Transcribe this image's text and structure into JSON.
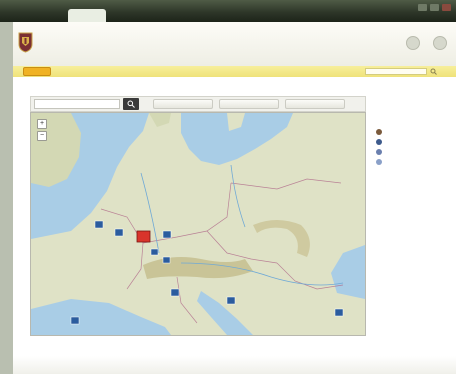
{
  "browser": {
    "tab_label": ""
  },
  "site": {
    "title": "",
    "header_links": [
      {
        "label": ""
      },
      {
        "label": ""
      }
    ]
  },
  "nav": {
    "menu_label": "",
    "links": [
      "",
      "",
      "",
      "",
      "",
      ""
    ],
    "search_placeholder": ""
  },
  "page": {
    "heading": ""
  },
  "map": {
    "search_placeholder": "",
    "toolbar_buttons": [
      "",
      "",
      ""
    ],
    "zoom_in_symbol": "+",
    "zoom_out_symbol": "−",
    "place_labels": [
      "",
      "",
      "",
      "",
      "",
      "",
      "",
      ""
    ]
  },
  "legend": {
    "title": "",
    "items": [
      {
        "label": "",
        "color": "#7a5a3c"
      },
      {
        "label": "",
        "color": "#3d5a8c"
      },
      {
        "label": "",
        "color": "#6a7fae"
      },
      {
        "label": "",
        "color": "#8aa0c8"
      }
    ]
  },
  "colors": {
    "nav_bar": "#efe27a",
    "menu_button": "#f0b223",
    "land": "#dfe2c6",
    "sea": "#a9cde6",
    "map_marker": "#2b5c9e",
    "selected_marker": "#d9342b"
  }
}
